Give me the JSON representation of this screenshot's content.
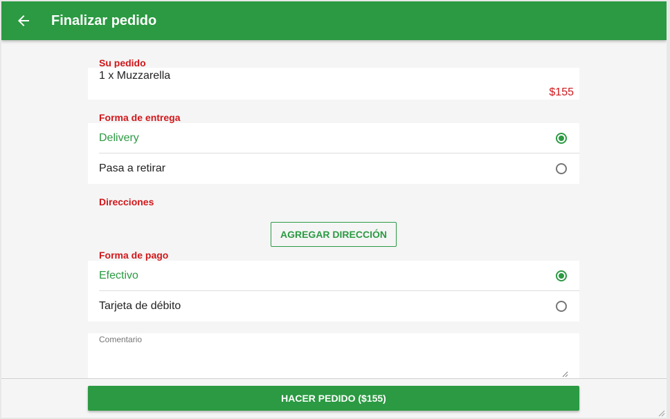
{
  "header": {
    "title": "Finalizar pedido",
    "back_icon": "arrow-back-icon"
  },
  "order": {
    "label": "Su pedido",
    "items": [
      {
        "text": "1 x Muzzarella"
      }
    ],
    "total": "$155"
  },
  "delivery": {
    "label": "Forma de entrega",
    "options": [
      {
        "label": "Delivery",
        "selected": true
      },
      {
        "label": "Pasa a retirar",
        "selected": false
      }
    ]
  },
  "addresses": {
    "label": "Direcciones",
    "add_button_label": "AGREGAR DIRECCIÓN"
  },
  "payment": {
    "label": "Forma de pago",
    "options": [
      {
        "label": "Efectivo",
        "selected": true
      },
      {
        "label": "Tarjeta de débito",
        "selected": false
      }
    ]
  },
  "comment": {
    "label": "Comentario",
    "value": ""
  },
  "footer": {
    "submit_label": "HACER PEDIDO ($155)"
  },
  "colors": {
    "primary": "#2b9a42",
    "accent": "#d0171b",
    "background": "#f5f5f5"
  }
}
